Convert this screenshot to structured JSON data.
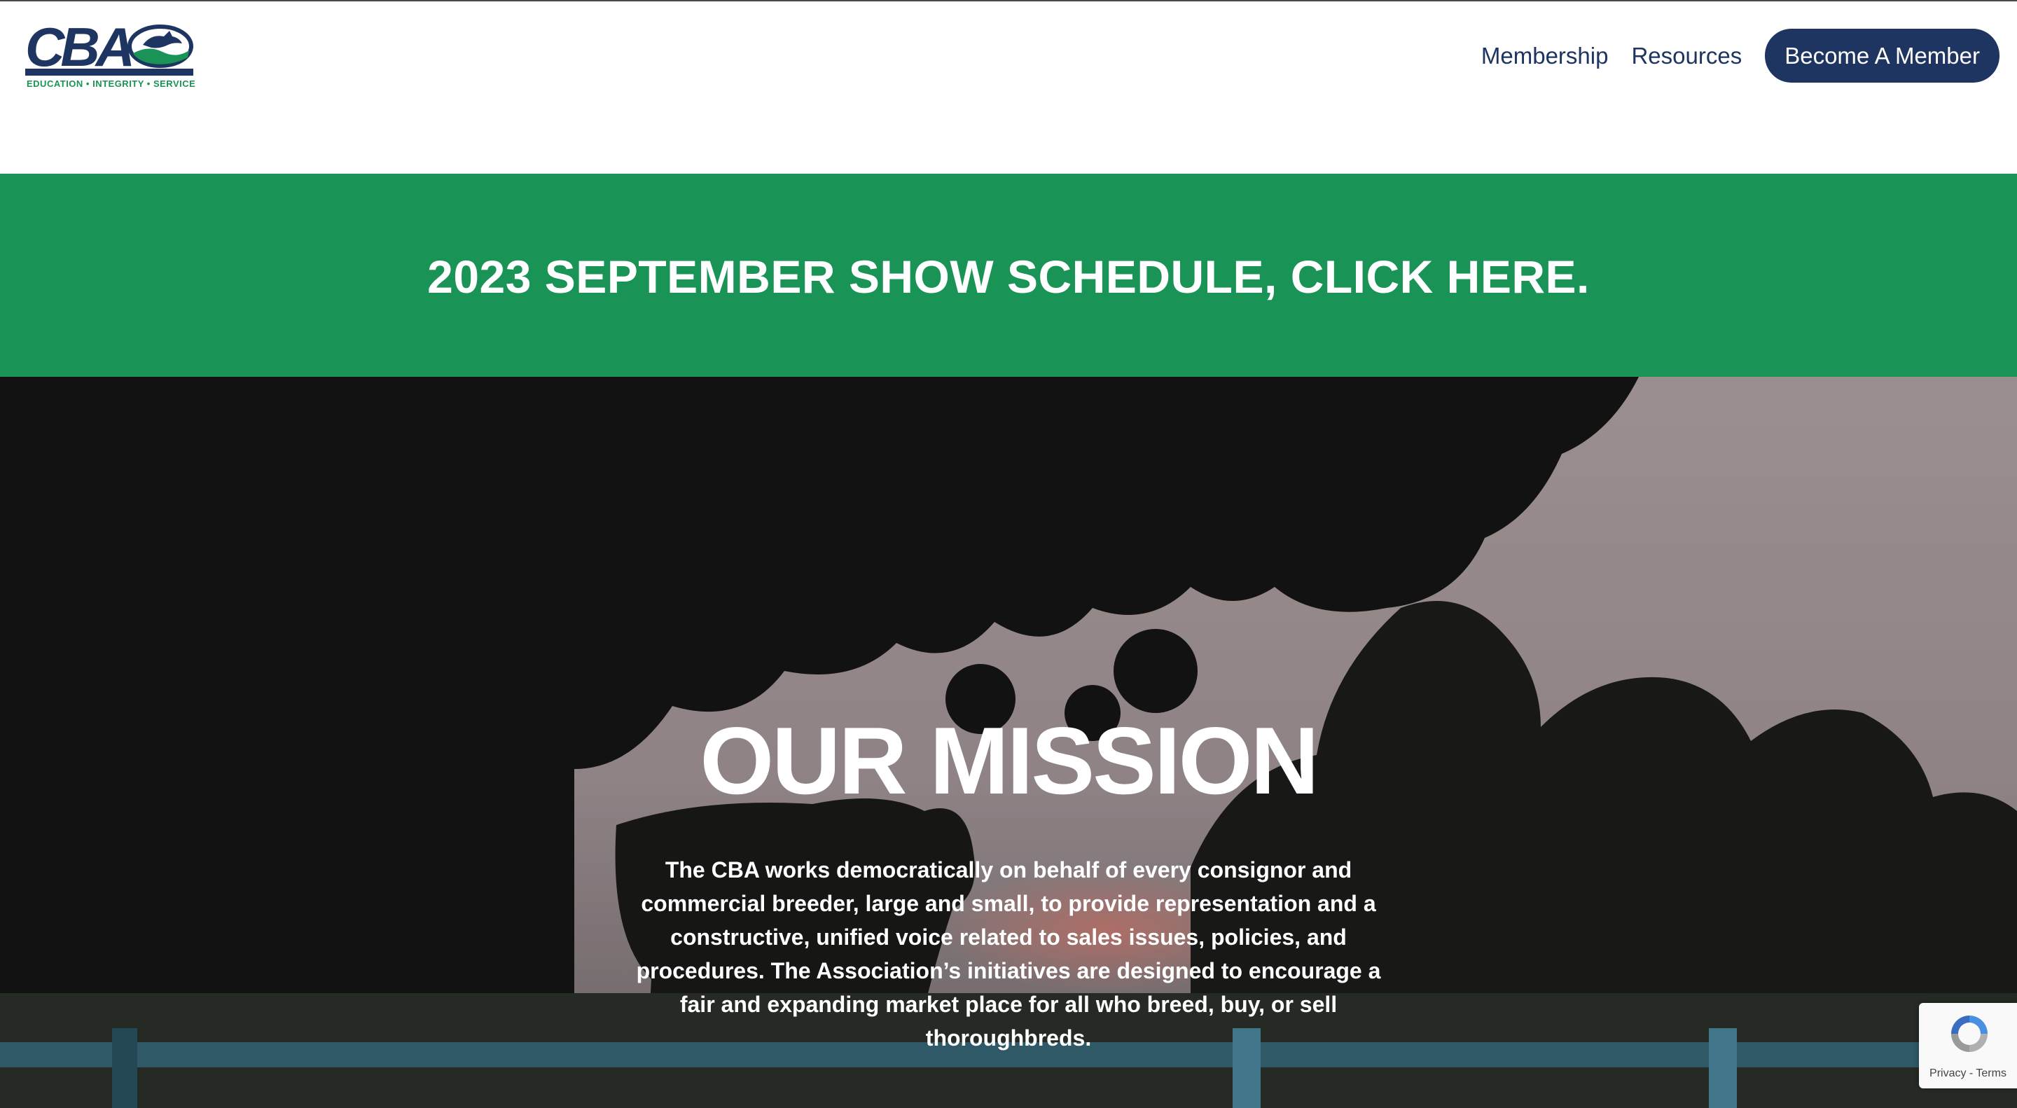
{
  "header": {
    "logo": {
      "letters": "CBA",
      "tagline": "EDUCATION • INTEGRITY • SERVICE"
    },
    "nav": {
      "items": [
        {
          "label": "Membership"
        },
        {
          "label": "Resources"
        }
      ],
      "cta_label": "Become A Member"
    }
  },
  "banner": {
    "text": "2023 SEPTEMBER SHOW SCHEDULE, CLICK HERE."
  },
  "hero": {
    "title": "OUR MISSION",
    "body": "The CBA works democratically on behalf of every consignor and commercial breeder, large and small, to provide representation and a constructive, unified voice related to sales issues, policies, and procedures. The Association’s initiatives are designed to encourage a fair and expanding market place for all who breed, buy, or sell thoroughbreds."
  },
  "recaptcha": {
    "privacy_label": "Privacy",
    "separator": " - ",
    "terms_label": "Terms"
  },
  "colors": {
    "brand_navy": "#1e3461",
    "brand_green": "#199456",
    "white": "#ffffff"
  },
  "icons": [
    "recaptcha-icon",
    "horse-emblem-icon"
  ]
}
